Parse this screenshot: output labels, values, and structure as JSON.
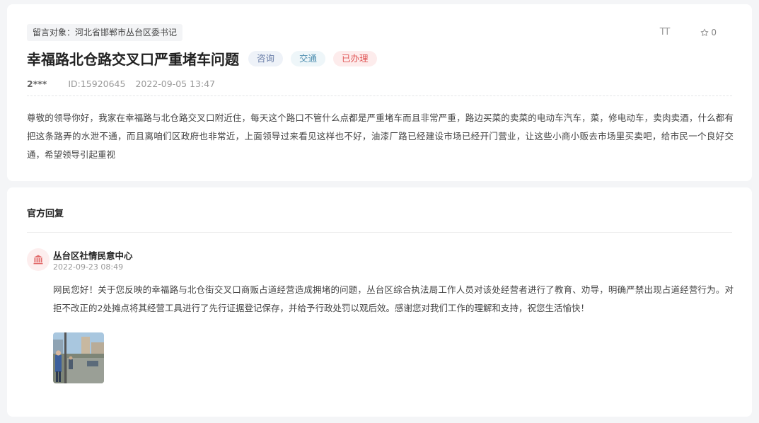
{
  "question": {
    "target_label": "留言对象：河北省邯郸市丛台区委书记",
    "title": "幸福路北仓路交叉口严重堵车问题",
    "badges": {
      "type": "咨询",
      "category": "交通",
      "status": "已办理"
    },
    "toolbar": {
      "font_size_label": "TT",
      "favorite_count": "0"
    },
    "meta": {
      "user": "2***",
      "id": "ID:15920645",
      "time": "2022-09-05 13:47"
    },
    "content": "尊敬的领导你好，我家在幸福路与北仓路交叉口附近住，每天这个路口不管什么点都是严重堵车而且非常严重，路边买菜的卖菜的电动车汽车，菜，修电动车，卖肉卖酒，什么都有把这条路弄的水泄不通，而且离咱们区政府也非常近，上面领导过来看见这样也不好，油漆厂路已经建设市场已经开门营业，让这些小商小贩去市场里买卖吧，给市民一个良好交通，希望领导引起重视"
  },
  "reply": {
    "heading": "官方回复",
    "org_name": "丛台区社情民意中心",
    "time": "2022-09-23 08:49",
    "text": "网民您好！关于您反映的幸福路与北仓街交叉口商贩占道经营造成拥堵的问题，丛台区综合执法局工作人员对该处经营者进行了教育、劝导，明确严禁出现占道经营行为。对拒不改正的2处摊点将其经营工具进行了先行证据登记保存，并给予行政处罚以观后效。感谢您对我们工作的理解和支持，祝您生活愉快！"
  },
  "colors": {
    "page_bg": "#f4f5f7",
    "badge_consult": "#6a7ea8",
    "badge_traffic": "#4f8fb0",
    "badge_done": "#e05656",
    "org_icon": "#e26a6a"
  },
  "icons": {
    "font_size": "font-size-icon",
    "favorite": "star-outline-icon",
    "org": "government-building-icon"
  }
}
